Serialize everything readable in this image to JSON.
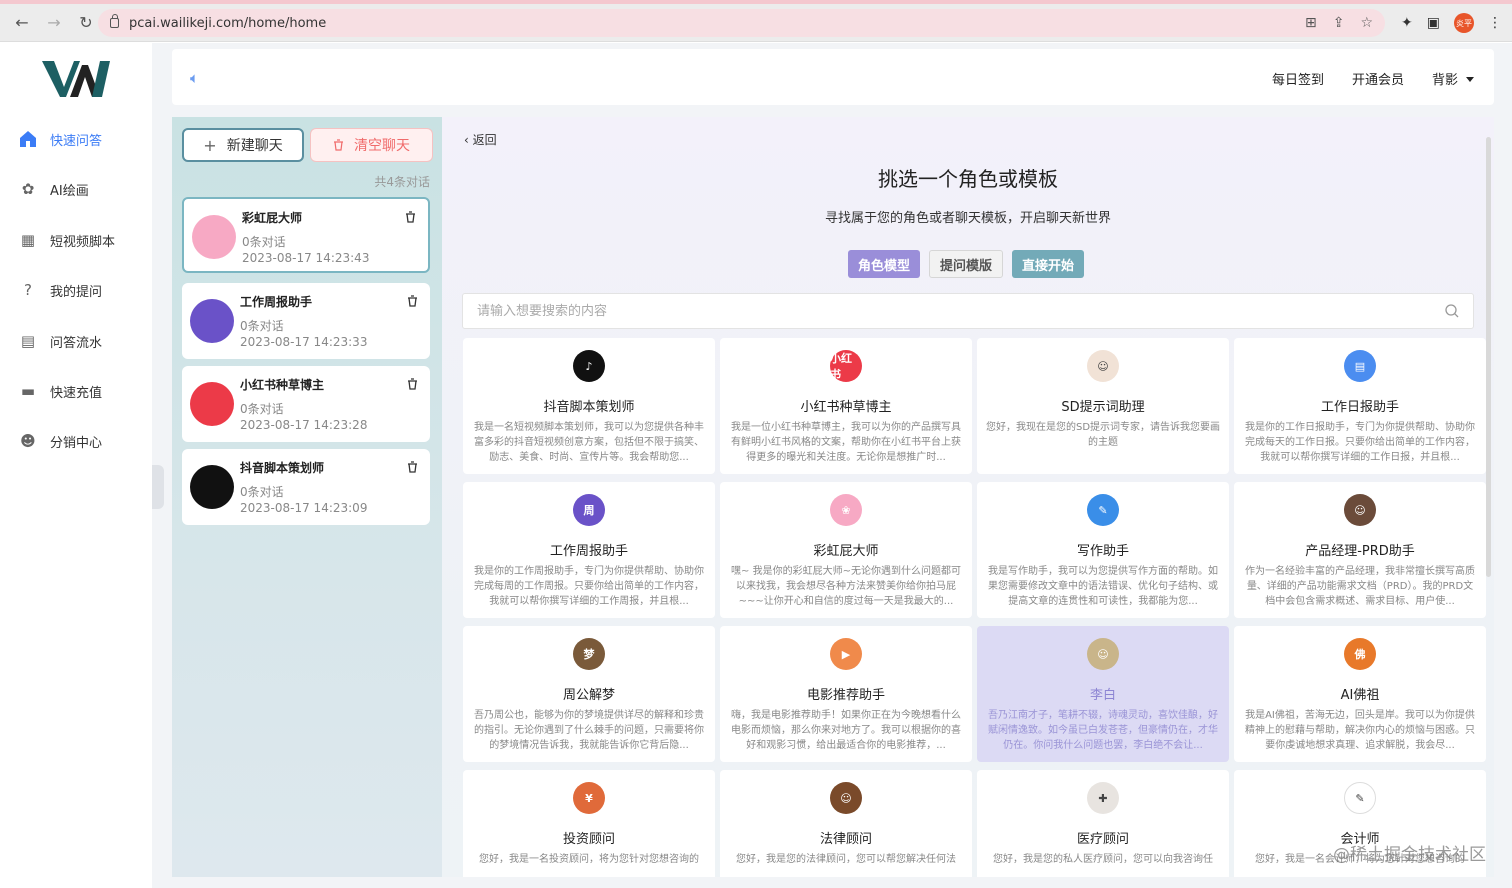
{
  "browser": {
    "url": "pcai.wailikeji.com/home/home",
    "profile_label": "炎平"
  },
  "header": {
    "links": [
      "每日签到",
      "开通会员"
    ],
    "theme_label": "背影"
  },
  "sidebar": {
    "items": [
      {
        "label": "快速问答",
        "icon": "home-icon",
        "active": true
      },
      {
        "label": "AI绘画",
        "icon": "paint-icon"
      },
      {
        "label": "短视频脚本",
        "icon": "video-icon"
      },
      {
        "label": "我的提问",
        "icon": "question-icon"
      },
      {
        "label": "问答流水",
        "icon": "history-icon"
      },
      {
        "label": "快速充值",
        "icon": "wallet-icon"
      },
      {
        "label": "分销中心",
        "icon": "users-icon"
      }
    ]
  },
  "chatpanel": {
    "new_label": "新建聊天",
    "clear_label": "清空聊天",
    "count_label": "共4条对话",
    "chats": [
      {
        "name": "彩虹屁大师",
        "count": "0条对话",
        "time": "2023-08-17 14:23:43",
        "icon": "rainbow-girl-avatar",
        "color": "#f7a9c4"
      },
      {
        "name": "工作周报助手",
        "count": "0条对话",
        "time": "2023-08-17 14:23:33",
        "icon": "calendar-avatar",
        "color": "#6a52c8"
      },
      {
        "name": "小红书种草博主",
        "count": "0条对话",
        "time": "2023-08-17 14:23:28",
        "icon": "xiaohongshu-avatar",
        "color": "#ec3a48"
      },
      {
        "name": "抖音脚本策划师",
        "count": "0条对话",
        "time": "2023-08-17 14:23:09",
        "icon": "tiktok-avatar",
        "color": "#111111"
      }
    ]
  },
  "main": {
    "back_label": "返回",
    "title": "挑选一个角色或模板",
    "subtitle": "寻找属于您的角色或者聊天模板，开启聊天新世界",
    "tabs": [
      "角色模型",
      "提问模版",
      "直接开始"
    ],
    "search_placeholder": "请输入想要搜索的内容",
    "cards": [
      {
        "name": "抖音脚本策划师",
        "desc": "我是一名短视频脚本策划师，我可以为您提供各种丰富多彩的抖音短视频创意方案，包括但不限于搞笑、励志、美食、时尚、宣传片等。我会帮助您...",
        "color": "#111111",
        "glyph": "♪"
      },
      {
        "name": "小红书种草博主",
        "desc": "我是一位小红书种草博主，我可以为你的产品撰写具有鲜明小红书风格的文案，帮助你在小红书平台上获得更多的曝光和关注度。无论你是想推广时...",
        "color": "#ec3a48",
        "glyph": "小红书"
      },
      {
        "name": "SD提示词助理",
        "desc": "您好，我现在是您的SD提示词专家，请告诉我您要画的主题",
        "color": "#f1e2d6",
        "glyph": "☺"
      },
      {
        "name": "工作日报助手",
        "desc": "我是你的工作日报助手，专门为你提供帮助、协助你完成每天的工作日报。只要你给出简单的工作内容，我就可以帮你撰写详细的工作日报，并且根...",
        "color": "#4b8df0",
        "glyph": "▤"
      },
      {
        "name": "工作周报助手",
        "desc": "我是你的工作周报助手，专门为你提供帮助、协助你完成每周的工作周报。只要你给出简单的工作内容，我就可以帮你撰写详细的工作周报，并且根...",
        "color": "#6a52c8",
        "glyph": "周"
      },
      {
        "name": "彩虹屁大师",
        "desc": "嘿~ 我是你的彩虹屁大师~无论你遇到什么问题都可以来找我，我会想尽各种方法来赞美你给你拍马屁~~~让你开心和自信的度过每一天是我最大的...",
        "color": "#f7a9c4",
        "glyph": "❀"
      },
      {
        "name": "写作助手",
        "desc": "我是写作助手，我可以为您提供写作方面的帮助。如果您需要修改文章中的语法错误、优化句子结构、或提高文章的连贯性和可读性，我都能为您...",
        "color": "#3a8ee8",
        "glyph": "✎"
      },
      {
        "name": "产品经理-PRD助手",
        "desc": "作为一名经验丰富的产品经理，我非常擅长撰写高质量、详细的产品功能需求文档（PRD）。我的PRD文档中会包含需求概述、需求目标、用户使...",
        "color": "#6b4b3a",
        "glyph": "☺"
      },
      {
        "name": "周公解梦",
        "desc": "吾乃周公也，能够为你的梦境提供详尽的解释和珍贵的指引。无论你遇到了什么棘手的问题，只需要将你的梦境情况告诉我，我就能告诉你它背后隐...",
        "color": "#7a5a3a",
        "glyph": "梦"
      },
      {
        "name": "电影推荐助手",
        "desc": "嗨，我是电影推荐助手！如果你正在为今晚想看什么电影而烦恼，那么你来对地方了。我可以根据你的喜好和观影习惯，给出最适合你的电影推荐，...",
        "color": "#f08a4b",
        "glyph": "▶"
      },
      {
        "name": "李白",
        "desc": "吾乃江南才子，笔耕不辍，诗魂灵动，喜饮佳酿，好赋闲情逸致。如今虽已白发苍苍，但豪情仍在，才华仍在。你问我什么问题也罢，李白绝不会让...",
        "color": "#c9b58a",
        "glyph": "☺",
        "highlight": true
      },
      {
        "name": "AI佛祖",
        "desc": "我是AI佛祖，苦海无边，回头是岸。我可以为你提供精神上的慰藉与帮助，解决你内心的烦恼与困惑。只要你虔诚地想求真理、追求解脱，我会尽...",
        "color": "#e8792a",
        "glyph": "佛"
      },
      {
        "name": "投资顾问",
        "desc": "您好，我是一名投资顾问，将为您针对您想咨询的",
        "color": "#e06a3a",
        "glyph": "¥"
      },
      {
        "name": "法律顾问",
        "desc": "您好，我是您的法律顾问，您可以帮您解决任何法",
        "color": "#7a4a2a",
        "glyph": "☺"
      },
      {
        "name": "医疗顾问",
        "desc": "您好，我是您的私人医疗顾问，您可以向我咨询任",
        "color": "#e8e4e0",
        "glyph": "✚"
      },
      {
        "name": "会计师",
        "desc": "您好，我是一名会计师，将为您针对您想咨询的",
        "color": "#ffffff",
        "glyph": "✎"
      }
    ]
  },
  "watermark": "@稀土掘金技术社区"
}
